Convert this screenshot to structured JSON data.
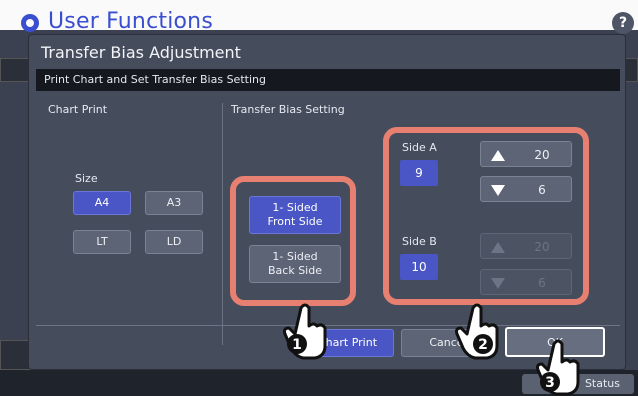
{
  "app": {
    "title": "User Functions",
    "help_label": "?",
    "status_label": "Status"
  },
  "dialog": {
    "title": "Transfer Bias Adjustment",
    "subheader": "Print Chart and Set Transfer Bias Setting",
    "chart_print_label": "Chart Print",
    "transfer_bias_label": "Transfer Bias Setting",
    "size_label": "Size",
    "sizes": [
      {
        "label": "A4",
        "selected": true
      },
      {
        "label": "A3",
        "selected": false
      },
      {
        "label": "LT",
        "selected": false
      },
      {
        "label": "LD",
        "selected": false
      }
    ],
    "front_side_label": "1- Sided\nFront Side",
    "back_side_label": "1- Sided\nBack Side",
    "side_a": {
      "label": "Side A",
      "value": "9",
      "up": "20",
      "down": "6"
    },
    "side_b": {
      "label": "Side B",
      "value": "10",
      "up": "20",
      "down": "6"
    },
    "footer": {
      "chart_print": "Chart Print",
      "cancel": "Cancel",
      "ok": "OK"
    }
  },
  "callouts": [
    "1",
    "2",
    "3"
  ],
  "colors": {
    "accent": "#4a56c6",
    "highlight": "#e88072",
    "dialog_bg": "#454c5c"
  }
}
